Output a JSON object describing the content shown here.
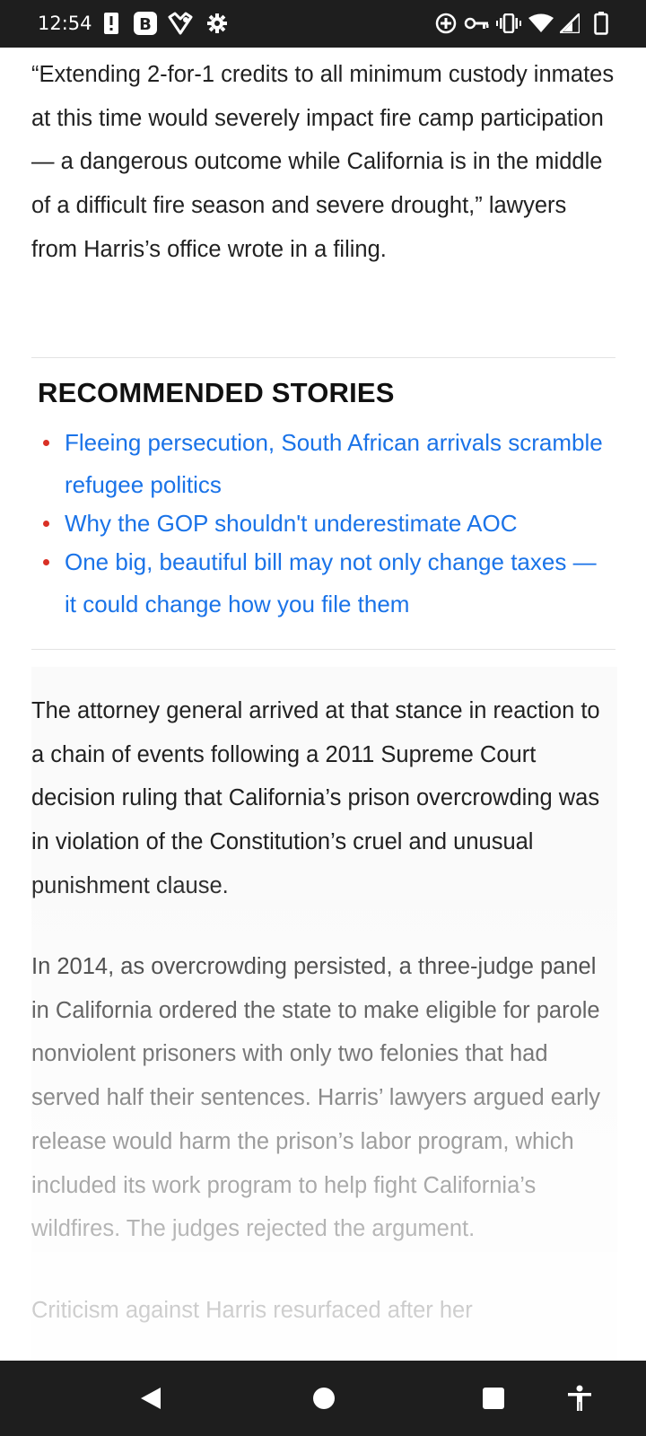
{
  "status_bar": {
    "time": "12:54",
    "left_icons": [
      "alert-icon",
      "b-app-icon",
      "brave-icon",
      "gear-icon"
    ],
    "right_icons": [
      "data-saver-icon",
      "vpn-key-icon",
      "vibrate-icon",
      "wifi-icon",
      "signal-icon",
      "battery-icon"
    ]
  },
  "article": {
    "paragraph_1": "“Extending 2-for-1 credits to all minimum custody inmates at this time would severely impact fire camp participation — a dangerous outcome while California is in the middle of a difficult fire season and severe drought,” lawyers from Harris’s office wrote in a filing.",
    "paragraph_2": "The attorney general arrived at that stance in reaction to a chain of events following a 2011 Supreme Court decision ruling that California’s prison overcrowding was in violation of the Constitution’s cruel and unusual punishment clause.",
    "paragraph_3": "In 2014, as overcrowding persisted, a three-judge panel in California ordered the state to make eligible for parole nonviolent prisoners with only two felonies that had served half their sentences. Harris’ lawyers argued early release would harm the prison’s labor program, which included its work program to help fight California’s wildfires. The judges rejected the argument.",
    "paragraph_4": "Criticism against Harris resurfaced after her"
  },
  "recommended": {
    "heading": "RECOMMENDED STORIES",
    "items": [
      {
        "label": "Fleeing persecution, South African arrivals scramble refugee politics"
      },
      {
        "label": "Why the GOP shouldn't underestimate AOC"
      },
      {
        "label": "One big, beautiful bill may not only change taxes — it could change how you file them"
      }
    ]
  },
  "colors": {
    "link": "#1a73e8",
    "bullet": "#d93025",
    "text": "#212121",
    "system_bar": "#1e1e1e"
  },
  "nav_bar": {
    "buttons": [
      "back-icon",
      "home-icon",
      "recents-icon",
      "accessibility-icon"
    ]
  }
}
